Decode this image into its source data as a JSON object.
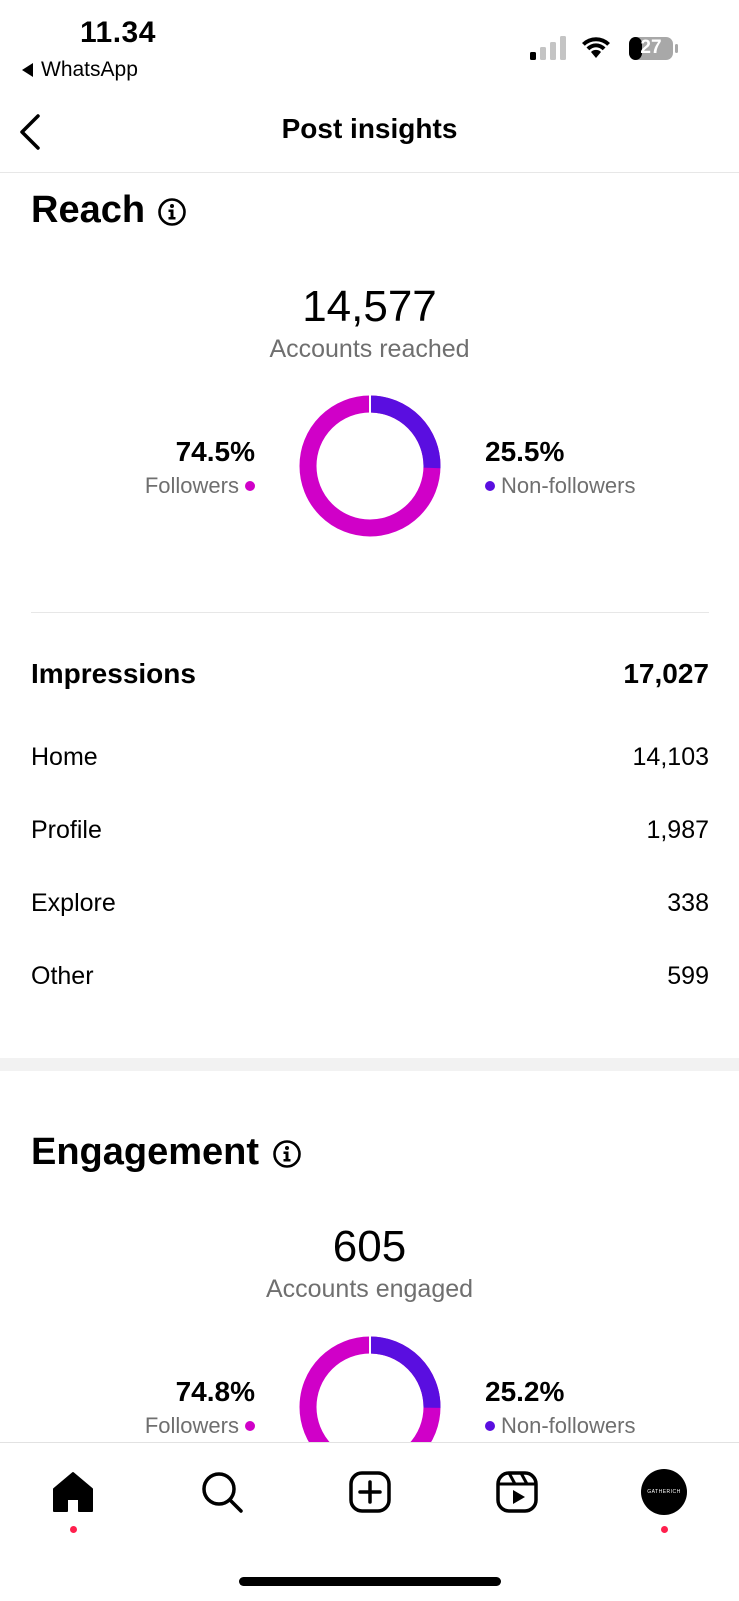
{
  "status_bar": {
    "time": "11.34",
    "back_app": "WhatsApp",
    "battery": "27"
  },
  "header": {
    "title": "Post insights"
  },
  "reach": {
    "title": "Reach",
    "total": "14,577",
    "total_label": "Accounts reached",
    "followers_pct": "74.5%",
    "followers_label": "Followers",
    "non_followers_pct": "25.5%",
    "non_followers_label": "Non-followers",
    "followers_share": 0.745
  },
  "impressions": {
    "label": "Impressions",
    "total": "17,027",
    "rows": [
      {
        "label": "Home",
        "value": "14,103"
      },
      {
        "label": "Profile",
        "value": "1,987"
      },
      {
        "label": "Explore",
        "value": "338"
      },
      {
        "label": "Other",
        "value": "599"
      }
    ]
  },
  "engagement": {
    "title": "Engagement",
    "total": "605",
    "total_label": "Accounts engaged",
    "followers_pct": "74.8%",
    "followers_label": "Followers",
    "non_followers_pct": "25.2%",
    "non_followers_label": "Non-followers",
    "followers_share": 0.748
  },
  "colors": {
    "followers": "#d000c8",
    "non_followers": "#5a0ee0",
    "nav_badge": "#ff1f4d"
  },
  "nav": {
    "items": [
      "home-icon",
      "search-icon",
      "create-icon",
      "reels-icon",
      "profile-avatar"
    ],
    "avatar_text": "GATHERICH"
  }
}
